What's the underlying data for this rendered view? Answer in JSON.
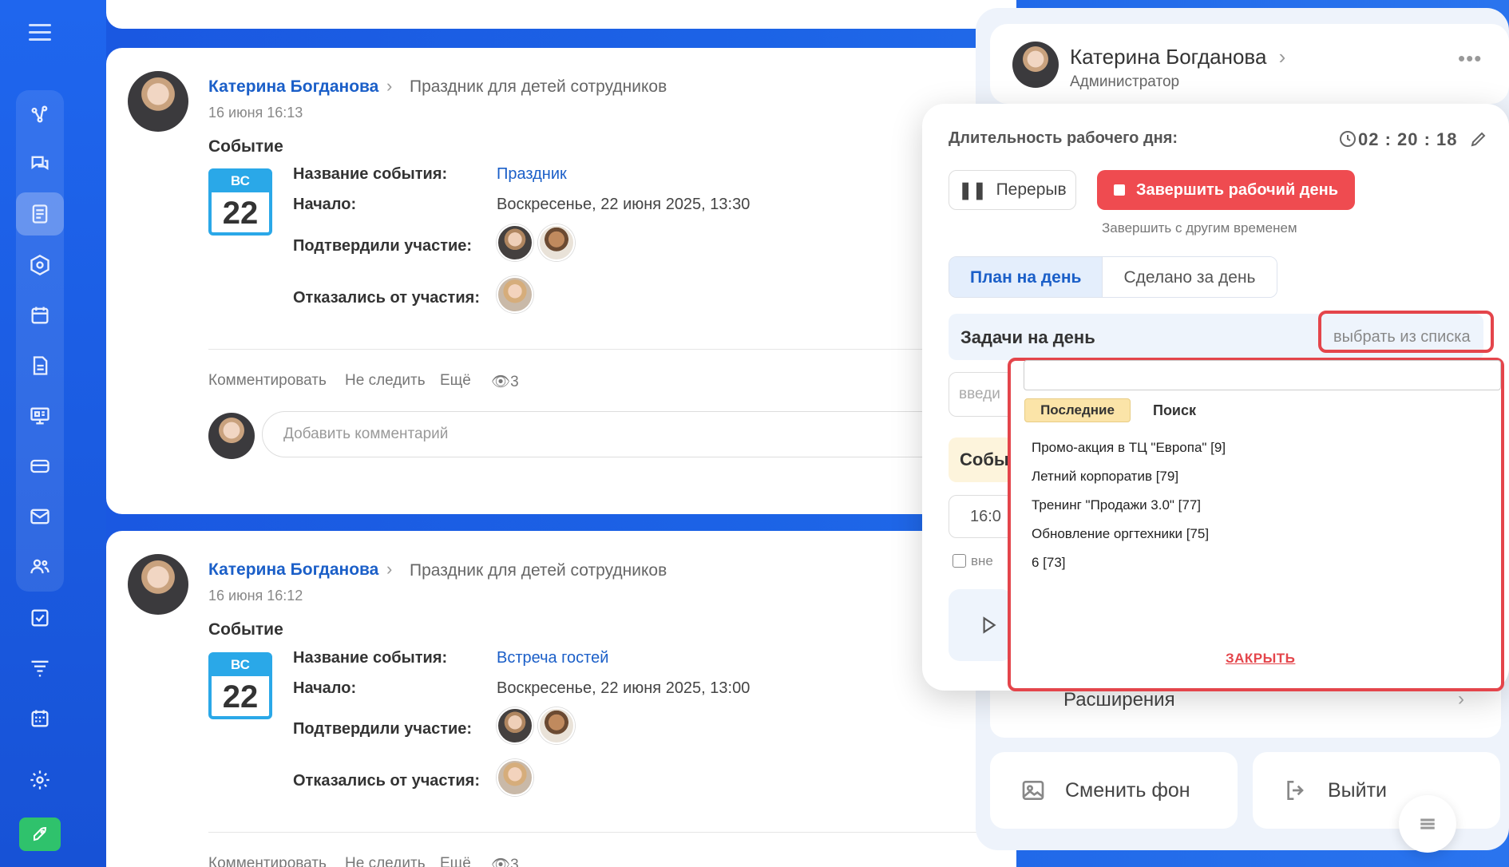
{
  "posts": [
    {
      "author": "Катерина Богданова",
      "target": "Праздник для детей сотрудников",
      "time": "16 июня 16:13",
      "type": "Событие",
      "calendar": {
        "day": "ВС",
        "date": "22"
      },
      "name_label": "Название события:",
      "name_value": "Праздник",
      "start_label": "Начало:",
      "start_value": "Воскресенье, 22 июня 2025, 13:30",
      "confirmed_label": "Подтвердили участие:",
      "declined_label": "Отказались от участия:",
      "actions": {
        "comment": "Комментировать",
        "unfollow": "Не следить",
        "more": "Ещё",
        "views": "3"
      },
      "comment_placeholder": "Добавить комментарий"
    },
    {
      "author": "Катерина Богданова",
      "target": "Праздник для детей сотрудников",
      "time": "16 июня 16:12",
      "type": "Событие",
      "calendar": {
        "day": "ВС",
        "date": "22"
      },
      "name_label": "Название события:",
      "name_value": "Встреча гостей",
      "start_label": "Начало:",
      "start_value": "Воскресенье, 22 июня 2025, 13:00",
      "confirmed_label": "Подтвердили участие:",
      "declined_label": "Отказались от участия:",
      "actions": {
        "comment": "Комментировать",
        "unfollow": "Не следить",
        "more": "Ещё",
        "views": "3"
      }
    }
  ],
  "profile": {
    "name": "Катерина Богданова",
    "role": "Администратор",
    "extensions": "Расширения",
    "change_bg": "Сменить фон",
    "logout": "Выйти"
  },
  "workday": {
    "title": "Длительность рабочего дня:",
    "timer": "02 : 20 : 18",
    "pause": "Перерыв",
    "end_day": "Завершить рабочий день",
    "end_other_time": "Завершить с другим временем",
    "tab_plan": "План на день",
    "tab_done": "Сделано за день",
    "tasks_label": "Задачи на день",
    "pick_from_list": "выбрать из списка",
    "ghost_input": "введи",
    "ghost_event": "Собы",
    "ghost_time": "16:0",
    "ghost_check": "вне"
  },
  "dropdown": {
    "tab_recent": "Последние",
    "tab_search": "Поиск",
    "items": [
      "Промо-акция в ТЦ \"Европа\" [9]",
      "Летний корпоратив [79]",
      "Тренинг \"Продажи 3.0\" [77]",
      "Обновление оргтехники [75]",
      "6 [73]"
    ],
    "close": "ЗАКРЫТЬ"
  },
  "colors": {
    "accent": "#1b5fc8",
    "danger": "#ef4b50",
    "highlight_frame": "#e4454b",
    "rail": "#1f66ee"
  }
}
